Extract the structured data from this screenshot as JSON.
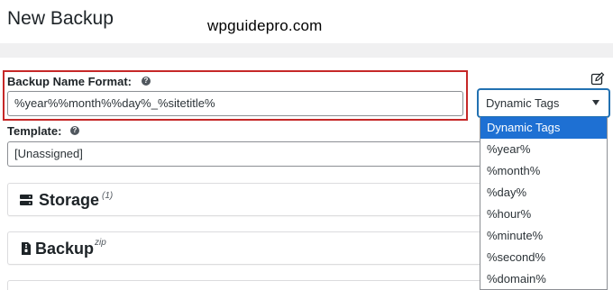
{
  "page": {
    "title": "New Backup",
    "watermark": "wpguidepro.com"
  },
  "form": {
    "backup_name_label": "Backup Name Format:",
    "backup_name_value": "%year%%month%%day%_%sitetitle%",
    "template_label": "Template:",
    "template_value": "[Unassigned]",
    "help_glyph": "?"
  },
  "sections": [
    {
      "title": "Storage",
      "sup": "(1)",
      "icon": "server-icon"
    },
    {
      "title": "Backup",
      "sup": "zip",
      "icon": "file-zip-icon"
    }
  ],
  "dynamic_tags": {
    "selected_label": "Dynamic Tags",
    "options": [
      "Dynamic Tags",
      "%year%",
      "%month%",
      "%day%",
      "%hour%",
      "%minute%",
      "%second%",
      "%domain%"
    ],
    "highlighted_index": 0,
    "highlight_color": "#1e70d3"
  },
  "colors": {
    "focus_border": "#2271b1",
    "highlight_box": "#c62828"
  },
  "icons": {
    "edit": "pencil-square-icon",
    "help": "question-circle-icon",
    "dropdown": "chevron-down-icon"
  }
}
